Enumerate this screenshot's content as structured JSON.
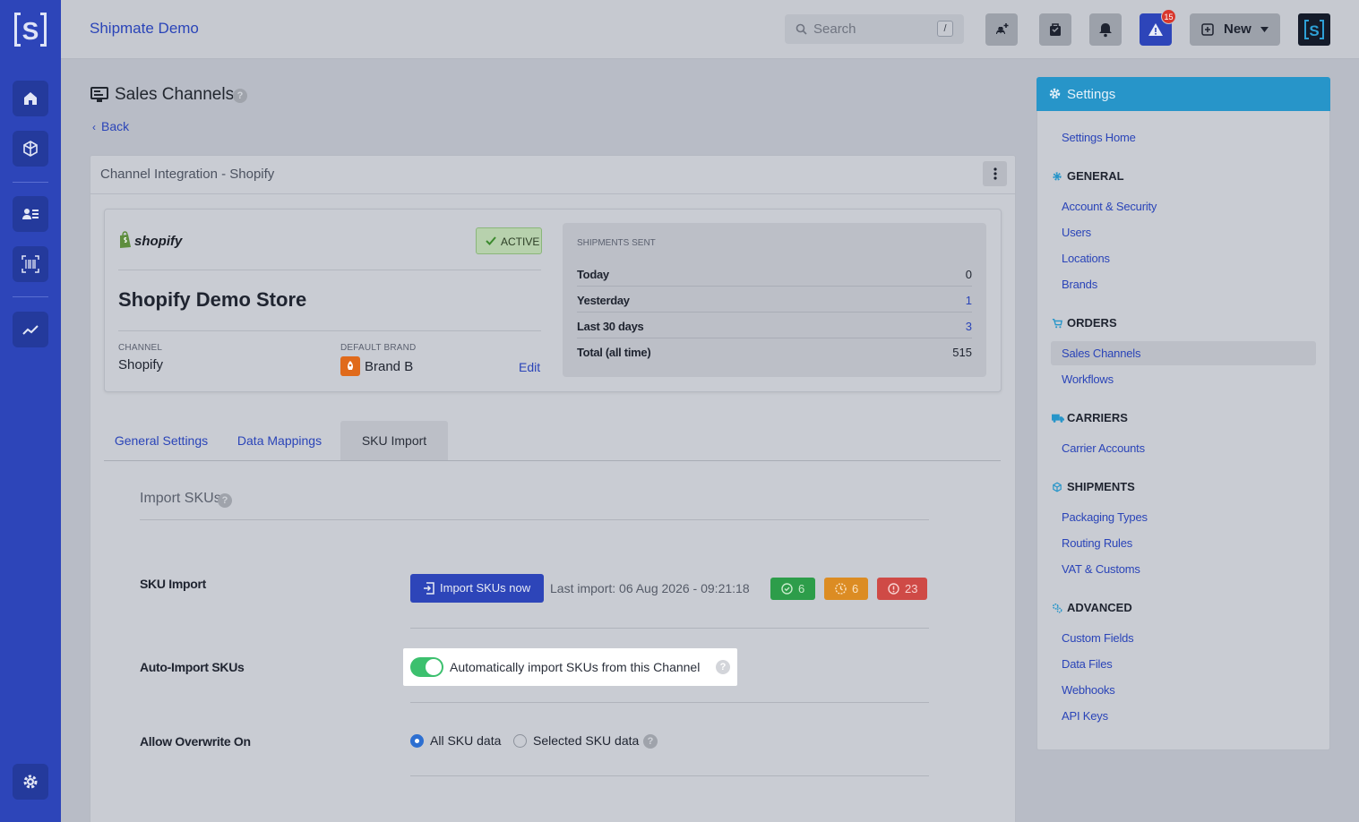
{
  "app": {
    "title": "Shipmate Demo",
    "logo_letter": "S"
  },
  "topbar": {
    "search_placeholder": "Search",
    "search_shortcut": "/",
    "alert_count": "15",
    "new_label": "New"
  },
  "page": {
    "title": "Sales Channels",
    "back_label": "Back",
    "card_title": "Channel Integration - Shopify"
  },
  "store": {
    "platform_logo": "shopify",
    "status": "ACTIVE",
    "name": "Shopify Demo Store",
    "channel_caption": "CHANNEL",
    "channel_value": "Shopify",
    "brand_caption": "DEFAULT BRAND",
    "brand_value": "Brand B",
    "edit_label": "Edit"
  },
  "shipments": {
    "title": "SHIPMENTS SENT",
    "rows": [
      {
        "label": "Today",
        "value": "0"
      },
      {
        "label": "Yesterday",
        "value": "1"
      },
      {
        "label": "Last 30 days",
        "value": "3"
      },
      {
        "label": "Total (all time)",
        "value": "515"
      }
    ]
  },
  "tabs": [
    {
      "label": "General Settings"
    },
    {
      "label": "Data Mappings"
    },
    {
      "label": "SKU Import",
      "active": true
    }
  ],
  "sku": {
    "section_title": "Import SKUs",
    "import_label": "SKU Import",
    "import_button": "Import SKUs now",
    "last_import": "Last import: 06 Aug 2026 - 09:21:18",
    "counts": {
      "success": "6",
      "pending": "6",
      "error": "23"
    },
    "auto_label": "Auto-Import SKUs",
    "auto_text": "Automatically import SKUs from this Channel",
    "auto_enabled": true,
    "overwrite_label": "Allow Overwrite On",
    "overwrite_options": [
      "All SKU data",
      "Selected SKU data"
    ],
    "overwrite_selected": "All SKU data"
  },
  "settings": {
    "title": "Settings",
    "home": "Settings Home",
    "sections": [
      {
        "title": "GENERAL",
        "items": [
          "Account & Security",
          "Users",
          "Locations",
          "Brands"
        ]
      },
      {
        "title": "ORDERS",
        "items": [
          "Sales Channels",
          "Workflows"
        ]
      },
      {
        "title": "CARRIERS",
        "items": [
          "Carrier Accounts"
        ]
      },
      {
        "title": "SHIPMENTS",
        "items": [
          "Packaging Types",
          "Routing Rules",
          "VAT & Customs"
        ]
      },
      {
        "title": "ADVANCED",
        "items": [
          "Custom Fields",
          "Data Files",
          "Webhooks",
          "API Keys"
        ]
      }
    ],
    "active_item": "Sales Channels"
  },
  "colors": {
    "primary": "#2d45b9",
    "settings_header": "#2795c9",
    "toggle_on": "#3cc06e",
    "success": "#2d9d4a",
    "warning": "#dc8c23",
    "error": "#cf4a46"
  }
}
